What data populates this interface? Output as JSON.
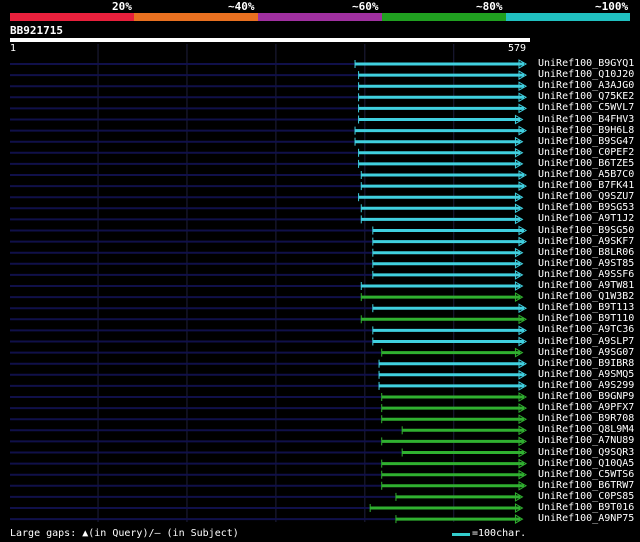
{
  "legend": {
    "labels": [
      "20%",
      "~40%",
      "~60%",
      "~80%",
      "~100%"
    ],
    "colors": [
      "#e8203c",
      "#e87020",
      "#a030a0",
      "#20a020",
      "#20c0c0"
    ]
  },
  "query": {
    "id": "BB921715",
    "start_label": "1",
    "end_label": "579",
    "length": 579
  },
  "colors": {
    "cyan": "#40d0e0",
    "green": "#30b030",
    "navy": "#10104a",
    "grid": "#1e1e3c"
  },
  "hits": [
    {
      "name": "UniRef100_B9GYQ1",
      "start": 389,
      "end": 579,
      "color": "cyan"
    },
    {
      "name": "UniRef100_Q10J20",
      "start": 393,
      "end": 579,
      "color": "cyan"
    },
    {
      "name": "UniRef100_A3AJG0",
      "start": 393,
      "end": 579,
      "color": "cyan"
    },
    {
      "name": "UniRef100_Q75KE2",
      "start": 393,
      "end": 579,
      "color": "cyan"
    },
    {
      "name": "UniRef100_C5WVL7",
      "start": 393,
      "end": 579,
      "color": "cyan"
    },
    {
      "name": "UniRef100_B4FHV3",
      "start": 393,
      "end": 575,
      "color": "cyan"
    },
    {
      "name": "UniRef100_B9H6L8",
      "start": 389,
      "end": 579,
      "color": "cyan"
    },
    {
      "name": "UniRef100_B9SG47",
      "start": 389,
      "end": 575,
      "color": "cyan"
    },
    {
      "name": "UniRef100_C0PEF2",
      "start": 393,
      "end": 575,
      "color": "cyan"
    },
    {
      "name": "UniRef100_B6TZE5",
      "start": 393,
      "end": 575,
      "color": "cyan"
    },
    {
      "name": "UniRef100_A5B7C0",
      "start": 396,
      "end": 579,
      "color": "cyan"
    },
    {
      "name": "UniRef100_B7FK41",
      "start": 396,
      "end": 579,
      "color": "cyan"
    },
    {
      "name": "UniRef100_Q9SZU7",
      "start": 393,
      "end": 575,
      "color": "cyan"
    },
    {
      "name": "UniRef100_B9SG53",
      "start": 396,
      "end": 575,
      "color": "cyan"
    },
    {
      "name": "UniRef100_A9T1J2",
      "start": 396,
      "end": 575,
      "color": "cyan"
    },
    {
      "name": "UniRef100_B9SG50",
      "start": 409,
      "end": 579,
      "color": "cyan"
    },
    {
      "name": "UniRef100_A9SKF7",
      "start": 409,
      "end": 579,
      "color": "cyan"
    },
    {
      "name": "UniRef100_B8LR06",
      "start": 409,
      "end": 575,
      "color": "cyan"
    },
    {
      "name": "UniRef100_A9ST85",
      "start": 409,
      "end": 575,
      "color": "cyan"
    },
    {
      "name": "UniRef100_A9SSF6",
      "start": 409,
      "end": 575,
      "color": "cyan"
    },
    {
      "name": "UniRef100_A9TW81",
      "start": 396,
      "end": 575,
      "color": "cyan"
    },
    {
      "name": "UniRef100_Q1W3B2",
      "start": 396,
      "end": 575,
      "color": "green"
    },
    {
      "name": "UniRef100_B9T113",
      "start": 409,
      "end": 579,
      "color": "cyan"
    },
    {
      "name": "UniRef100_B9T110",
      "start": 396,
      "end": 579,
      "color": "green"
    },
    {
      "name": "UniRef100_A9TC36",
      "start": 409,
      "end": 579,
      "color": "cyan"
    },
    {
      "name": "UniRef100_A9SLP7",
      "start": 409,
      "end": 579,
      "color": "cyan"
    },
    {
      "name": "UniRef100_A9SG07",
      "start": 419,
      "end": 575,
      "color": "green"
    },
    {
      "name": "UniRef100_B9IBR8",
      "start": 416,
      "end": 579,
      "color": "cyan"
    },
    {
      "name": "UniRef100_A9SMQ5",
      "start": 416,
      "end": 579,
      "color": "cyan"
    },
    {
      "name": "UniRef100_A9S299",
      "start": 416,
      "end": 579,
      "color": "cyan"
    },
    {
      "name": "UniRef100_B9GNP9",
      "start": 419,
      "end": 579,
      "color": "green"
    },
    {
      "name": "UniRef100_A9PFX7",
      "start": 419,
      "end": 579,
      "color": "green"
    },
    {
      "name": "UniRef100_B9R708",
      "start": 419,
      "end": 579,
      "color": "green"
    },
    {
      "name": "UniRef100_Q8L9M4",
      "start": 442,
      "end": 579,
      "color": "green"
    },
    {
      "name": "UniRef100_A7NU89",
      "start": 419,
      "end": 579,
      "color": "green"
    },
    {
      "name": "UniRef100_Q9SQR3",
      "start": 442,
      "end": 579,
      "color": "green"
    },
    {
      "name": "UniRef100_Q10QA5",
      "start": 419,
      "end": 579,
      "color": "green"
    },
    {
      "name": "UniRef100_C5WTS6",
      "start": 419,
      "end": 579,
      "color": "green"
    },
    {
      "name": "UniRef100_B6TRW7",
      "start": 419,
      "end": 579,
      "color": "green"
    },
    {
      "name": "UniRef100_C0PS85",
      "start": 435,
      "end": 575,
      "color": "green"
    },
    {
      "name": "UniRef100_B9T016",
      "start": 406,
      "end": 575,
      "color": "green"
    },
    {
      "name": "UniRef100_A9NP75",
      "start": 435,
      "end": 575,
      "color": "green"
    }
  ],
  "footer": {
    "gaps_text": "Large gaps: ▲(in Query)/— (in Subject)",
    "scale_text": "=100char."
  }
}
